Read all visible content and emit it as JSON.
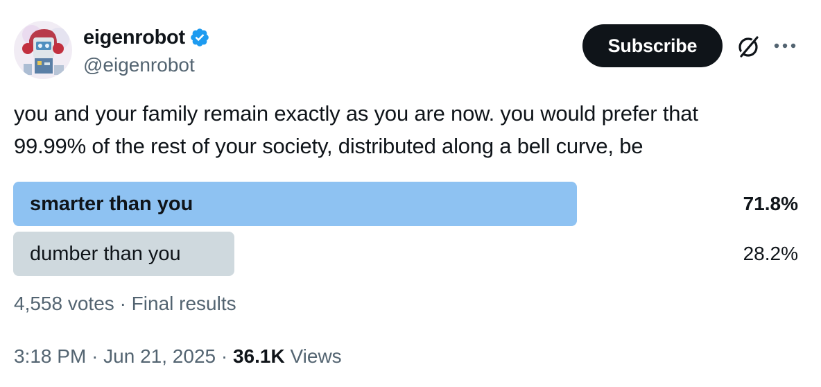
{
  "author": {
    "display_name": "eigenrobot",
    "handle": "@eigenrobot",
    "verified": true,
    "verified_color": "#1d9bf0"
  },
  "actions": {
    "subscribe_label": "Subscribe",
    "grok_icon": "grok-icon",
    "more_icon": "more-icon"
  },
  "tweet": {
    "text_line1": "you and your family remain exactly as you are now. you would prefer that",
    "text_line2": "99.99% of the rest of your society, distributed along a bell curve, be"
  },
  "poll": {
    "options": [
      {
        "label": "smarter than you",
        "percent_text": "71.8%",
        "percent": 71.8,
        "winner": true,
        "color": "#8ec2f2"
      },
      {
        "label": "dumber than you",
        "percent_text": "28.2%",
        "percent": 28.2,
        "winner": false,
        "color": "#cfd9de"
      }
    ],
    "votes": "4,558 votes",
    "separator": "·",
    "status": "Final results"
  },
  "meta": {
    "time": "3:18 PM",
    "date": "Jun 21, 2025",
    "separator": "·",
    "views_count": "36.1K",
    "views_label": "Views"
  }
}
